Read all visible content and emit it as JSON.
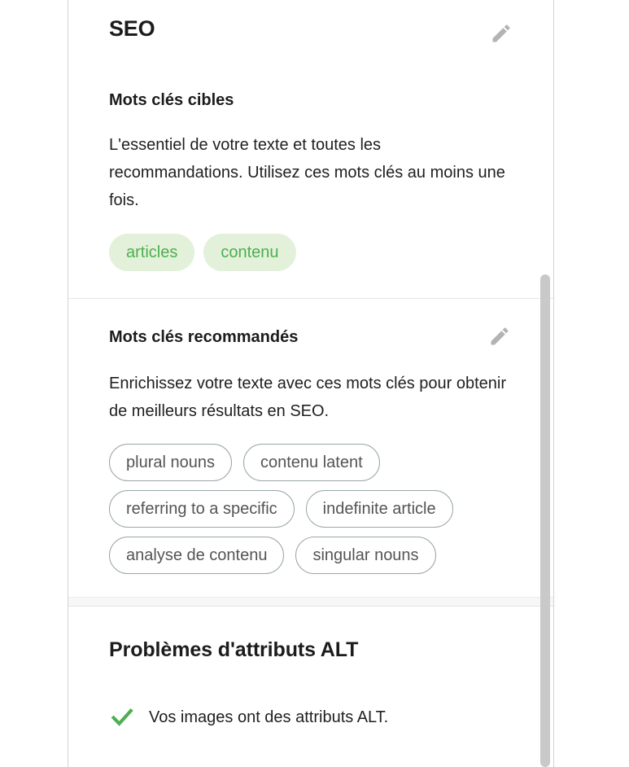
{
  "panel": {
    "title": "SEO",
    "edit_icon": "pencil-icon"
  },
  "target_keywords": {
    "heading": "Mots clés cibles",
    "description": "L'essentiel de votre texte et toutes les recommandations. Utilisez ces mots clés au moins une fois.",
    "tags": [
      "articles",
      "contenu"
    ],
    "tag_bg_color": "#e3f1da",
    "tag_text_color": "#4caf50"
  },
  "recommended_keywords": {
    "heading": "Mots clés recommandés",
    "edit_icon": "pencil-icon",
    "description": "Enrichissez votre texte avec ces mots clés pour obtenir de meilleurs résultats en SEO.",
    "pills": [
      "plural nouns",
      "contenu latent",
      "referring to a specific",
      "indefinite article",
      "analyse de contenu",
      "singular nouns"
    ],
    "pill_border_color": "#9aa5a7",
    "pill_text_color": "#545454"
  },
  "alt_attributes": {
    "heading": "Problèmes d'attributs ALT",
    "items": [
      {
        "status": "ok",
        "icon": "check-icon",
        "label": "Vos images ont des attributs ALT."
      }
    ],
    "ok_color": "#4caf50"
  },
  "scrollbar": {
    "thumb_color": "#c9c9c9"
  }
}
